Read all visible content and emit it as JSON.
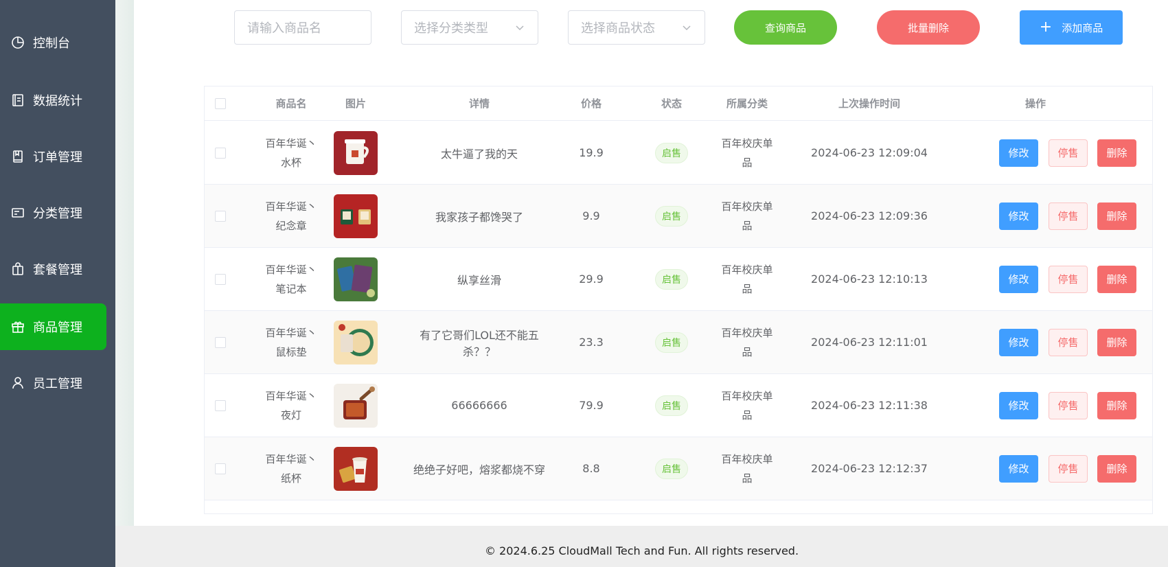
{
  "sidebar": {
    "items": [
      {
        "label": "控制台",
        "icon": "pie-chart-icon",
        "active": false
      },
      {
        "label": "数据统计",
        "icon": "notebook-icon",
        "active": false
      },
      {
        "label": "订单管理",
        "icon": "book-icon",
        "active": false
      },
      {
        "label": "分类管理",
        "icon": "card-icon",
        "active": false
      },
      {
        "label": "套餐管理",
        "icon": "bag-icon",
        "active": false
      },
      {
        "label": "商品管理",
        "icon": "gift-icon",
        "active": true
      },
      {
        "label": "员工管理",
        "icon": "user-icon",
        "active": false
      }
    ]
  },
  "toolbar": {
    "name_placeholder": "请输入商品名",
    "category_placeholder": "选择分类类型",
    "status_placeholder": "选择商品状态",
    "query_label": "查询商品",
    "batch_delete_label": "批量删除",
    "add_label": "添加商品"
  },
  "table": {
    "headers": {
      "name": "商品名",
      "image": "图片",
      "detail": "详情",
      "price": "价格",
      "status": "状态",
      "category": "所属分类",
      "time": "上次操作时间",
      "actions": "操作"
    },
    "actions": {
      "edit": "修改",
      "stop": "停售",
      "delete": "删除"
    },
    "rows": [
      {
        "name_line1": "百年华诞丶",
        "name_line2": "水杯",
        "detail": "太牛逼了我的天",
        "price": "19.9",
        "status": "启售",
        "category": "百年校庆单品",
        "time": "2024-06-23 12:09:04",
        "thumb": "cup-thumbnail"
      },
      {
        "name_line1": "百年华诞丶",
        "name_line2": "纪念章",
        "detail": "我家孩子都馋哭了",
        "price": "9.9",
        "status": "启售",
        "category": "百年校庆单品",
        "time": "2024-06-23 12:09:36",
        "thumb": "badge-thumbnail"
      },
      {
        "name_line1": "百年华诞丶",
        "name_line2": "笔记本",
        "detail": "纵享丝滑",
        "price": "29.9",
        "status": "启售",
        "category": "百年校庆单品",
        "time": "2024-06-23 12:10:13",
        "thumb": "notebook-thumbnail"
      },
      {
        "name_line1": "百年华诞丶",
        "name_line2": "鼠标垫",
        "detail": "有了它哥们LOL还不能五杀？？",
        "price": "23.3",
        "status": "启售",
        "category": "百年校庆单品",
        "time": "2024-06-23 12:11:01",
        "thumb": "mousepad-thumbnail"
      },
      {
        "name_line1": "百年华诞丶",
        "name_line2": "夜灯",
        "detail": "66666666",
        "price": "79.9",
        "status": "启售",
        "category": "百年校庆单品",
        "time": "2024-06-23 12:11:38",
        "thumb": "nightlight-thumbnail"
      },
      {
        "name_line1": "百年华诞丶",
        "name_line2": "纸杯",
        "detail": "绝绝子好吧，熔浆都烧不穿",
        "price": "8.8",
        "status": "启售",
        "category": "百年校庆单品",
        "time": "2024-06-23 12:12:37",
        "thumb": "papercup-thumbnail"
      }
    ]
  },
  "footer": {
    "text": "© 2024.6.25 CloudMall Tech and Fun. All rights reserved."
  },
  "colors": {
    "sidebar_bg": "#434f5f",
    "active_nav": "#0db11e",
    "query_btn": "#67c23a",
    "batch_delete_btn": "#f56c6c",
    "add_btn": "#409eff"
  }
}
